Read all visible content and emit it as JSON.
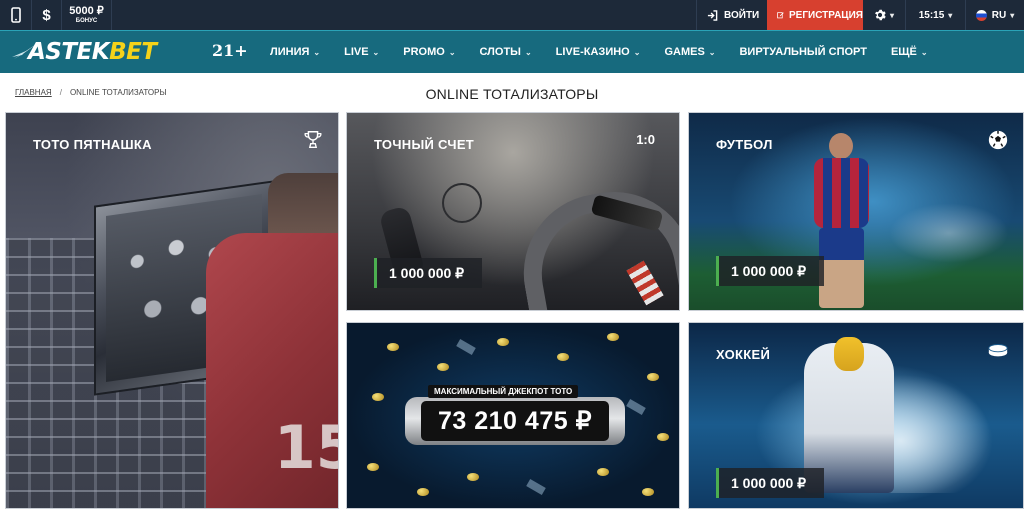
{
  "topbar": {
    "bonus_amount": "5000 ₽",
    "bonus_label": "БОНУС",
    "dollar_symbol": "$",
    "login_label": "ВОЙТИ",
    "register_label": "РЕГИСТРАЦИЯ",
    "time": "15:15",
    "language": "RU"
  },
  "nav": {
    "logo_part1": "ASTEK",
    "logo_part2": "BET",
    "age_badge": "21+",
    "items": [
      {
        "label": "ЛИНИЯ",
        "has_dropdown": true
      },
      {
        "label": "LIVE",
        "has_dropdown": true
      },
      {
        "label": "PROMO",
        "has_dropdown": true
      },
      {
        "label": "СЛОТЫ",
        "has_dropdown": true
      },
      {
        "label": "LIVE-КАЗИНО",
        "has_dropdown": true
      },
      {
        "label": "GAMES",
        "has_dropdown": true
      },
      {
        "label": "ВИРТУАЛЬНЫЙ СПОРТ",
        "has_dropdown": false
      },
      {
        "label": "ЕЩЁ",
        "has_dropdown": true
      }
    ]
  },
  "breadcrumb": {
    "home": "ГЛАВНАЯ",
    "separator": "/",
    "current": "ONLINE ТОТАЛИЗАТОРЫ"
  },
  "page_title": "ONLINE ТОТАЛИЗАТОРЫ",
  "cards": {
    "toto": {
      "title": "ТОТО ПЯТНАШКА",
      "icon": "trophy-icon",
      "jersey_number": "15"
    },
    "score": {
      "title": "ТОЧНЫЙ СЧЕТ",
      "badge": "1:0",
      "amount": "1 000 000 ₽"
    },
    "football": {
      "title": "ФУТБОЛ",
      "icon": "soccer-ball-icon",
      "amount": "1 000 000 ₽"
    },
    "jackpot": {
      "label": "МАКСИМАЛЬНЫЙ ДЖЕКПОТ ТОТО",
      "amount": "73 210 475 ₽"
    },
    "hockey": {
      "title": "ХОККЕЙ",
      "icon": "hockey-puck-icon",
      "amount": "1 000 000 ₽"
    }
  },
  "colors": {
    "topbar_bg": "#1d2939",
    "nav_bg": "#176a7e",
    "register_bg": "#d7402f",
    "logo_accent": "#f5d21a",
    "price_accent": "#4caf50"
  }
}
